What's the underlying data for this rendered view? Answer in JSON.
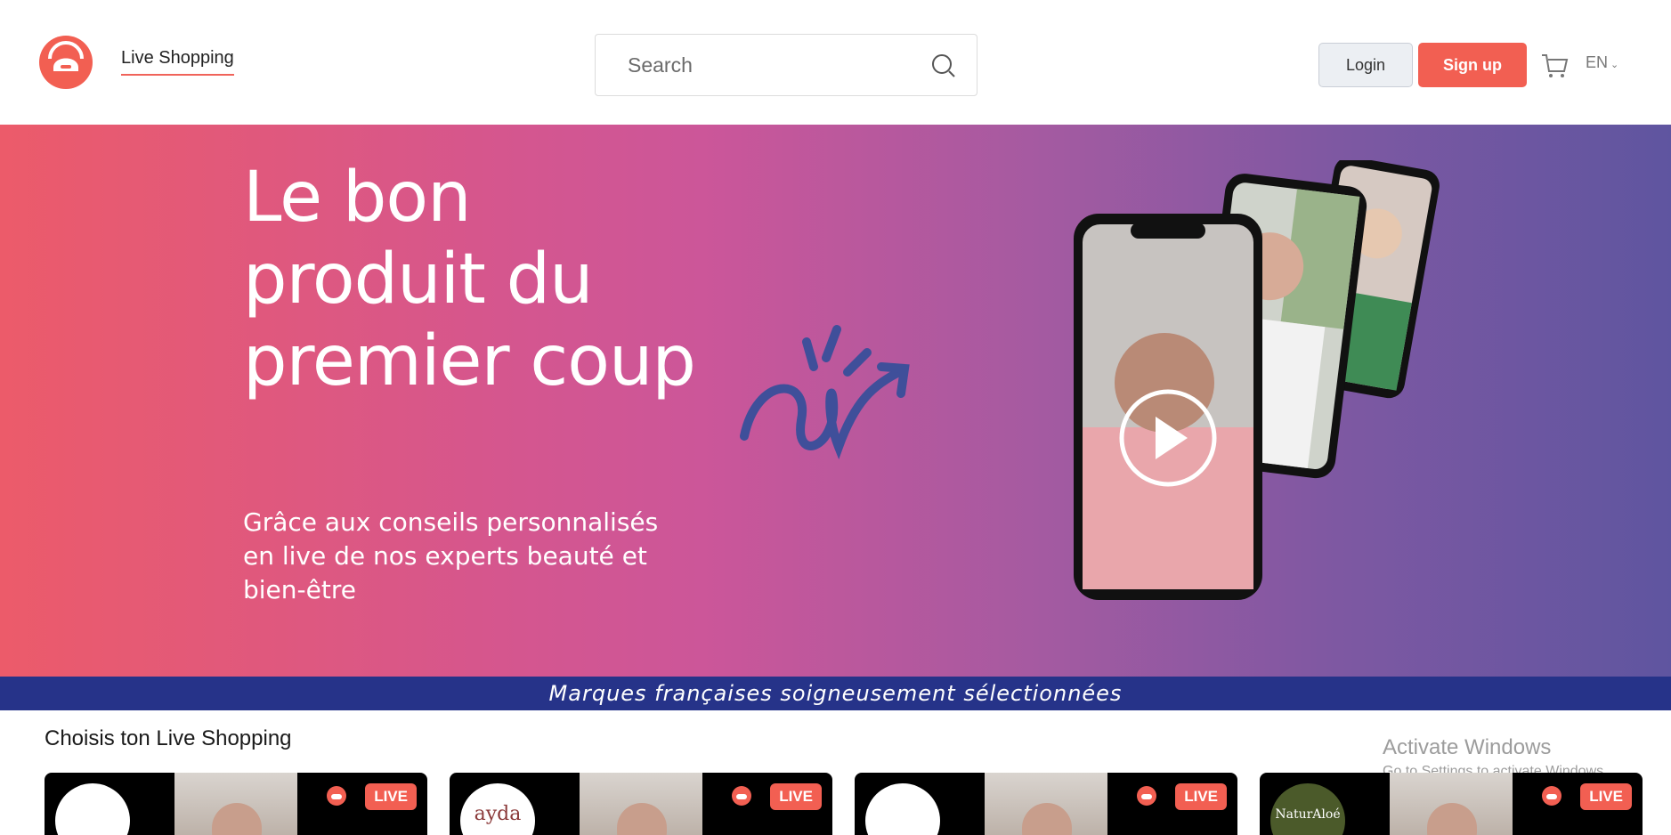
{
  "header": {
    "brand_label": "Live Shopping",
    "search": {
      "placeholder": "Search"
    },
    "login_label": "Login",
    "signup_label": "Sign up",
    "language": "EN"
  },
  "hero": {
    "title": "Le bon produit du premier coup",
    "subtitle": "Grâce aux conseils personnalisés en live de nos experts beauté et bien-être"
  },
  "strip": {
    "text": "Marques françaises soigneusement sélectionnées"
  },
  "section": {
    "title": "Choisis ton Live Shopping"
  },
  "cards": [
    {
      "brand": "",
      "badge": "LIVE"
    },
    {
      "brand": "ayda",
      "badge": "LIVE"
    },
    {
      "brand": "",
      "badge": "LIVE"
    },
    {
      "brand": "NaturAloé",
      "badge": "LIVE"
    }
  ],
  "watermark": {
    "line1": "Activate Windows",
    "line2": "Go to Settings to activate Windows."
  },
  "colors": {
    "accent": "#f25f52",
    "strip": "#263389",
    "scribble": "#3f4f9a"
  },
  "icons": [
    "logo-icon",
    "search-icon",
    "cart-icon",
    "chevron-down-icon",
    "play-icon",
    "live-logo-icon"
  ]
}
